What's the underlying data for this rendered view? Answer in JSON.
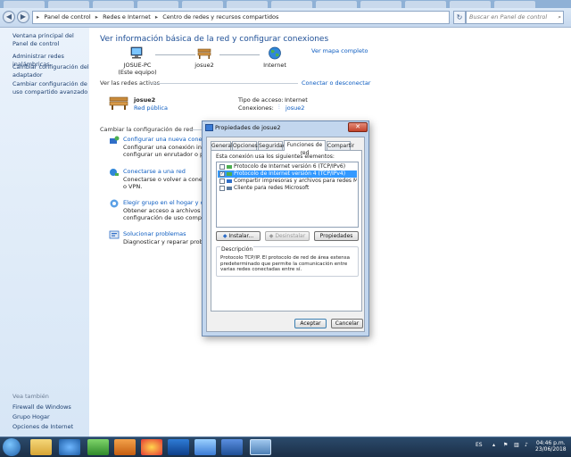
{
  "address": {
    "crumbs": [
      "Panel de control",
      "Redes e Internet",
      "Centro de redes y recursos compartidos"
    ],
    "search_placeholder": "Buscar en Panel de control"
  },
  "sidebar": {
    "items": [
      {
        "label": "Ventana principal del Panel de control"
      },
      {
        "label": "Administrar redes inalámbricas"
      },
      {
        "label": "Cambiar configuración del adaptador"
      },
      {
        "label": "Cambiar configuración de uso compartido avanzado"
      }
    ],
    "see_also_label": "Vea también",
    "see_also": [
      {
        "label": "Firewall de Windows"
      },
      {
        "label": "Grupo Hogar"
      },
      {
        "label": "Opciones de Internet"
      }
    ]
  },
  "main": {
    "title": "Ver información básica de la red y configurar conexiones",
    "map_link": "Ver mapa completo",
    "nodes": [
      {
        "label": "JOSUE-PC",
        "sub": "(Este equipo)"
      },
      {
        "label": "josue2",
        "sub": ""
      },
      {
        "label": "Internet",
        "sub": ""
      }
    ],
    "active_header": "Ver las redes activas",
    "connect_link": "Conectar o desconectar",
    "network": {
      "name": "josue2",
      "category": "Red pública",
      "access_label": "Tipo de acceso:",
      "access_value": "Internet",
      "conn_label": "Conexiones:",
      "conn_value": "josue2"
    },
    "change_header": "Cambiar la configuración de red",
    "tasks": [
      {
        "title": "Configurar una nueva conexión o red",
        "desc": [
          "Configurar una conexión inalámbrica,",
          "configurar un enrutador o punto de acceso."
        ]
      },
      {
        "title": "Conectarse a una red",
        "desc": [
          "Conectarse o volver a conectarse a una",
          "o VPN."
        ]
      },
      {
        "title": "Elegir grupo en el hogar y opciones de uso compartido",
        "desc": [
          "Obtener acceso a archivos e impresoras",
          "configuración de uso compartido."
        ]
      },
      {
        "title": "Solucionar problemas",
        "desc": [
          "Diagnosticar y reparar problemas de red."
        ]
      }
    ]
  },
  "dialog": {
    "title": "Propiedades de josue2",
    "close": "✕",
    "tabs": [
      "General",
      "Opciones",
      "Seguridad",
      "Funciones de red",
      "Compartir"
    ],
    "active_tab": "Funciones de red",
    "list_label": "Esta conexión usa los siguientes elementos:",
    "items": [
      {
        "label": "Protocolo de Internet versión 6 (TCP/IPv6)",
        "checked": false,
        "selected": false
      },
      {
        "label": "Protocolo de Internet versión 4 (TCP/IPv4)",
        "checked": true,
        "selected": true
      },
      {
        "label": "Compartir impresoras y archivos para redes Microsoft",
        "checked": false,
        "selected": false
      },
      {
        "label": "Cliente para redes Microsoft",
        "checked": false,
        "selected": false
      }
    ],
    "install_btn": "Instalar...",
    "uninstall_btn": "Desinstalar",
    "props_btn": "Propiedades",
    "desc_title": "Descripción",
    "desc_text": "Protocolo TCP/IP. El protocolo de red de área extensa predeterminado que permite la comunicación entre varias redes conectadas entre sí.",
    "accept_btn": "Aceptar",
    "cancel_btn": "Cancelar"
  },
  "taskbar": {
    "lang": "ES",
    "time": "04:46 p.m.",
    "date": "23/06/2018"
  },
  "colors": {
    "link": "#0b5bc0",
    "title": "#1e4f96",
    "selection": "#3399ff"
  }
}
